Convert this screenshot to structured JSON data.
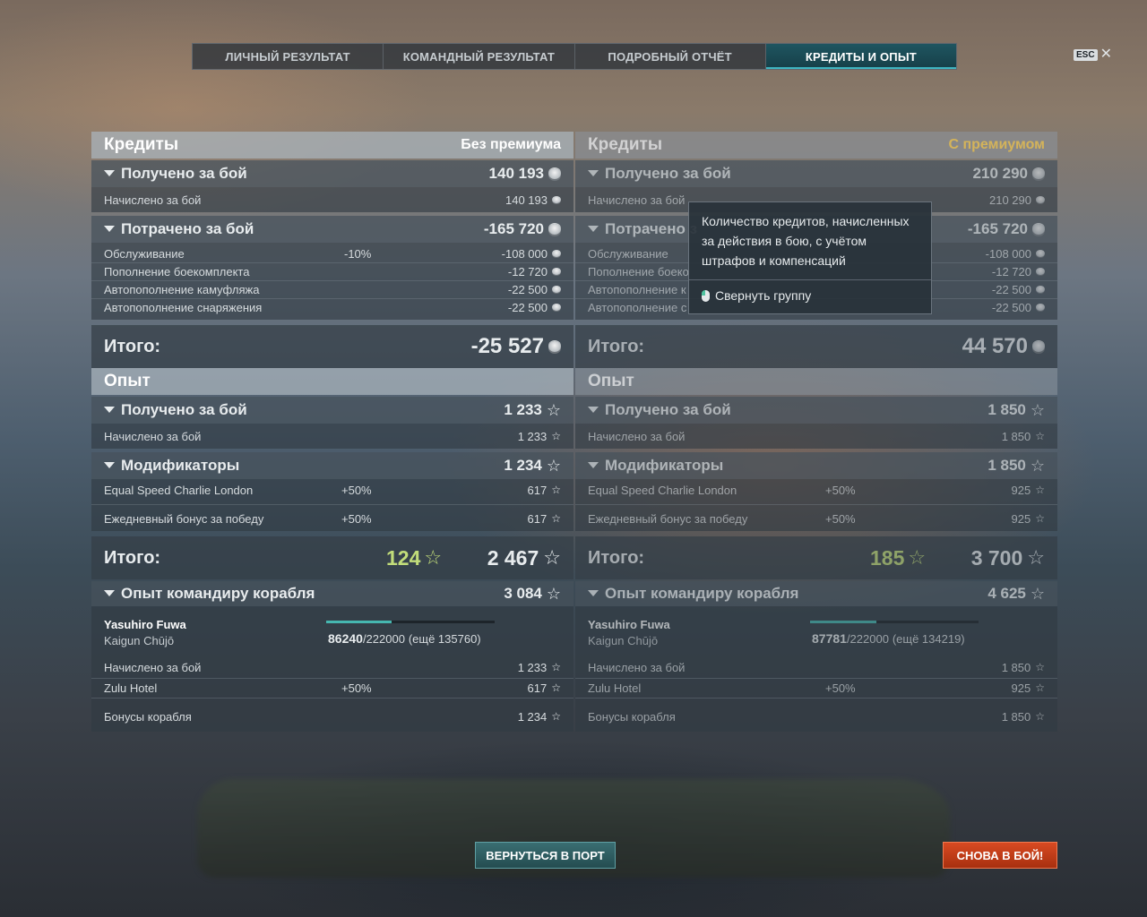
{
  "tabs": [
    {
      "label": "ЛИЧНЫЙ РЕЗУЛЬТАТ"
    },
    {
      "label": "КОМАНДНЫЙ РЕЗУЛЬТАТ"
    },
    {
      "label": "ПОДРОБНЫЙ ОТЧЁТ"
    },
    {
      "label": "КРЕДИТЫ И ОПЫТ"
    }
  ],
  "esc_label": "ESC",
  "close_glyph": "✕",
  "left": {
    "credits_title": "Кредиты",
    "mode": "Без премиума",
    "earned_label": "Получено за бой",
    "earned_value": "140 193",
    "accrued_label": "Начислено за бой",
    "accrued_value": "140 193",
    "spent_label": "Потрачено за бой",
    "spent_value": "-165 720",
    "service_label": "Обслуживание",
    "service_pct": "-10%",
    "service_value": "-108 000",
    "ammo_label": "Пополнение боекомплекта",
    "ammo_value": "-12 720",
    "camo_label": "Автопополнение камуфляжа",
    "camo_value": "-22 500",
    "equip_label": "Автопополнение снаряжения",
    "equip_value": "-22 500",
    "credits_total_label": "Итого:",
    "credits_total": "-25 527",
    "xp_title": "Опыт",
    "xp_earned_label": "Получено за бой",
    "xp_earned_value": "1 233",
    "xp_accrued_label": "Начислено за бой",
    "xp_accrued_value": "1 233",
    "mods_label": "Модификаторы",
    "mods_value": "1 234",
    "mod1_label": "Equal Speed Charlie London",
    "mod1_pct": "+50%",
    "mod1_value": "617",
    "mod2_label": "Ежедневный бонус за победу",
    "mod2_pct": "+50%",
    "mod2_value": "617",
    "xp_total_label": "Итого:",
    "xp_free": "124",
    "xp_total": "2 467",
    "cmd_label": "Опыт командиру корабля",
    "cmd_value": "3 084",
    "cmd_name": "Yasuhiro Fuwa",
    "cmd_ship": "Kaigun Chūjō",
    "cmd_current": "86240",
    "cmd_max": "/222000",
    "cmd_remaining": "(ещё 135760)",
    "cmd_progress": 0.388,
    "cmd_accrued_label": "Начислено за бой",
    "cmd_accrued_value": "1 233",
    "cmd_flag_label": "Zulu Hotel",
    "cmd_flag_pct": "+50%",
    "cmd_flag_value": "617",
    "cmd_ship_bonus_label": "Бонусы корабля",
    "cmd_ship_bonus_value": "1 234"
  },
  "right": {
    "credits_title": "Кредиты",
    "mode": "С премиумом",
    "earned_label": "Получено за бой",
    "earned_value": "210 290",
    "accrued_label": "Начислено за бой",
    "accrued_value": "210 290",
    "spent_label": "Потрачено з",
    "spent_value": "-165 720",
    "service_label": "Обслуживание",
    "service_value": "-108 000",
    "ammo_label": "Пополнение боеко",
    "ammo_value": "-12 720",
    "camo_label": "Автопополнение к",
    "camo_value": "-22 500",
    "equip_label": "Автопополнение с",
    "equip_value": "-22 500",
    "credits_total_label": "Итого:",
    "credits_total": "44 570",
    "xp_title": "Опыт",
    "xp_earned_label": "Получено за бой",
    "xp_earned_value": "1 850",
    "xp_accrued_label": "Начислено за бой",
    "xp_accrued_value": "1 850",
    "mods_label": "Модификаторы",
    "mods_value": "1 850",
    "mod1_label": "Equal Speed Charlie London",
    "mod1_pct": "+50%",
    "mod1_value": "925",
    "mod2_label": "Ежедневный бонус за победу",
    "mod2_pct": "+50%",
    "mod2_value": "925",
    "xp_total_label": "Итого:",
    "xp_free": "185",
    "xp_total": "3 700",
    "cmd_label": "Опыт командиру корабля",
    "cmd_value": "4 625",
    "cmd_name": "Yasuhiro Fuwa",
    "cmd_ship": "Kaigun Chūjō",
    "cmd_current": "87781",
    "cmd_max": "/222000",
    "cmd_remaining": "(ещё 134219)",
    "cmd_progress": 0.395,
    "cmd_accrued_label": "Начислено за бой",
    "cmd_accrued_value": "1 850",
    "cmd_flag_label": "Zulu Hotel",
    "cmd_flag_pct": "+50%",
    "cmd_flag_value": "925",
    "cmd_ship_bonus_label": "Бонусы корабля",
    "cmd_ship_bonus_value": "1 850"
  },
  "tooltip": {
    "text": "Количество кредитов, начисленных за действия в бою, с учётом штрафов и компенсаций",
    "hint": "Свернуть группу"
  },
  "buttons": {
    "port": "ВЕРНУТЬСЯ В ПОРТ",
    "battle": "СНОВА В БОЙ!"
  },
  "icons": {
    "credits": "credit-coin-icon",
    "xp": "star-icon",
    "expand": "triangle-down-icon",
    "mouse": "mouse-left-click-icon"
  },
  "colors": {
    "free_xp": "#c2dd7a",
    "premium": "#d4b35a",
    "active_tab": "#1f5560",
    "battle_button": "#d84a22",
    "port_button": "#3a6e72"
  }
}
